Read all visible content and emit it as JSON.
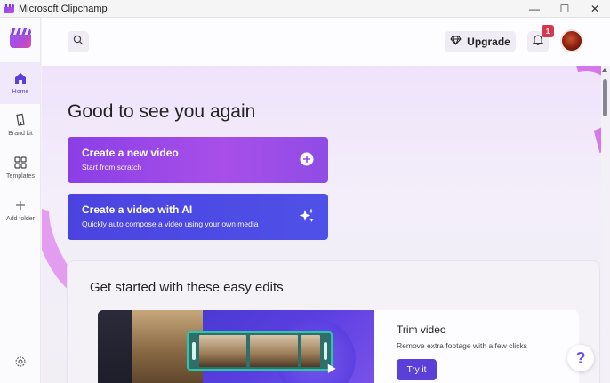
{
  "window": {
    "title": "Microsoft Clipchamp",
    "minimize": "—",
    "maximize": "☐",
    "close": "✕"
  },
  "sidebar": {
    "items": [
      {
        "label": "Home",
        "icon": "home-icon"
      },
      {
        "label": "Brand kit",
        "icon": "brand-kit-icon"
      },
      {
        "label": "Templates",
        "icon": "templates-icon"
      },
      {
        "label": "Add folder",
        "icon": "plus-icon"
      }
    ],
    "settings_icon": "gear-icon"
  },
  "header": {
    "upgrade_label": "Upgrade",
    "notification_count": "1"
  },
  "main": {
    "greeting": "Good to see you again",
    "cta": [
      {
        "title": "Create a new video",
        "subtitle": "Start from scratch",
        "icon": "plus-circle-icon"
      },
      {
        "title": "Create a video with AI",
        "subtitle": "Quickly auto compose a video using your own media",
        "icon": "sparkle-icon"
      }
    ],
    "edits": {
      "title": "Get started with these easy edits",
      "feature": {
        "title": "Trim video",
        "description": "Remove extra footage with a few clicks",
        "button": "Try it"
      }
    },
    "help": "?"
  },
  "colors": {
    "accent": "#6b4ef0",
    "cta_purple": "#9b47e8",
    "cta_blue": "#4b4ae4",
    "badge": "#d6384d"
  }
}
